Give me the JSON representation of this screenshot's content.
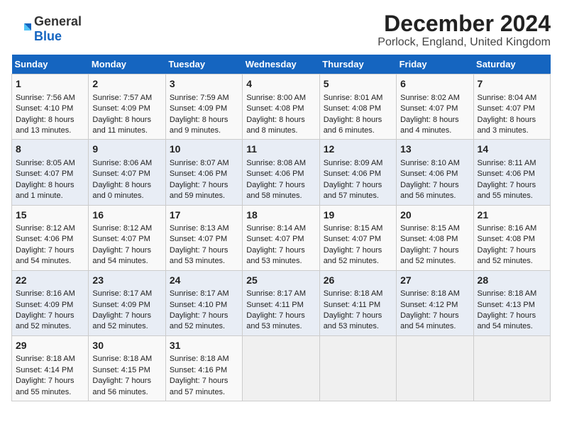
{
  "header": {
    "logo_general": "General",
    "logo_blue": "Blue",
    "month_title": "December 2024",
    "location": "Porlock, England, United Kingdom"
  },
  "weekdays": [
    "Sunday",
    "Monday",
    "Tuesday",
    "Wednesday",
    "Thursday",
    "Friday",
    "Saturday"
  ],
  "weeks": [
    [
      {
        "day": "1",
        "sunrise": "7:56 AM",
        "sunset": "4:10 PM",
        "daylight": "8 hours and 13 minutes."
      },
      {
        "day": "2",
        "sunrise": "7:57 AM",
        "sunset": "4:09 PM",
        "daylight": "8 hours and 11 minutes."
      },
      {
        "day": "3",
        "sunrise": "7:59 AM",
        "sunset": "4:09 PM",
        "daylight": "8 hours and 9 minutes."
      },
      {
        "day": "4",
        "sunrise": "8:00 AM",
        "sunset": "4:08 PM",
        "daylight": "8 hours and 8 minutes."
      },
      {
        "day": "5",
        "sunrise": "8:01 AM",
        "sunset": "4:08 PM",
        "daylight": "8 hours and 6 minutes."
      },
      {
        "day": "6",
        "sunrise": "8:02 AM",
        "sunset": "4:07 PM",
        "daylight": "8 hours and 4 minutes."
      },
      {
        "day": "7",
        "sunrise": "8:04 AM",
        "sunset": "4:07 PM",
        "daylight": "8 hours and 3 minutes."
      }
    ],
    [
      {
        "day": "8",
        "sunrise": "8:05 AM",
        "sunset": "4:07 PM",
        "daylight": "8 hours and 1 minute."
      },
      {
        "day": "9",
        "sunrise": "8:06 AM",
        "sunset": "4:07 PM",
        "daylight": "8 hours and 0 minutes."
      },
      {
        "day": "10",
        "sunrise": "8:07 AM",
        "sunset": "4:06 PM",
        "daylight": "7 hours and 59 minutes."
      },
      {
        "day": "11",
        "sunrise": "8:08 AM",
        "sunset": "4:06 PM",
        "daylight": "7 hours and 58 minutes."
      },
      {
        "day": "12",
        "sunrise": "8:09 AM",
        "sunset": "4:06 PM",
        "daylight": "7 hours and 57 minutes."
      },
      {
        "day": "13",
        "sunrise": "8:10 AM",
        "sunset": "4:06 PM",
        "daylight": "7 hours and 56 minutes."
      },
      {
        "day": "14",
        "sunrise": "8:11 AM",
        "sunset": "4:06 PM",
        "daylight": "7 hours and 55 minutes."
      }
    ],
    [
      {
        "day": "15",
        "sunrise": "8:12 AM",
        "sunset": "4:06 PM",
        "daylight": "7 hours and 54 minutes."
      },
      {
        "day": "16",
        "sunrise": "8:12 AM",
        "sunset": "4:07 PM",
        "daylight": "7 hours and 54 minutes."
      },
      {
        "day": "17",
        "sunrise": "8:13 AM",
        "sunset": "4:07 PM",
        "daylight": "7 hours and 53 minutes."
      },
      {
        "day": "18",
        "sunrise": "8:14 AM",
        "sunset": "4:07 PM",
        "daylight": "7 hours and 53 minutes."
      },
      {
        "day": "19",
        "sunrise": "8:15 AM",
        "sunset": "4:07 PM",
        "daylight": "7 hours and 52 minutes."
      },
      {
        "day": "20",
        "sunrise": "8:15 AM",
        "sunset": "4:08 PM",
        "daylight": "7 hours and 52 minutes."
      },
      {
        "day": "21",
        "sunrise": "8:16 AM",
        "sunset": "4:08 PM",
        "daylight": "7 hours and 52 minutes."
      }
    ],
    [
      {
        "day": "22",
        "sunrise": "8:16 AM",
        "sunset": "4:09 PM",
        "daylight": "7 hours and 52 minutes."
      },
      {
        "day": "23",
        "sunrise": "8:17 AM",
        "sunset": "4:09 PM",
        "daylight": "7 hours and 52 minutes."
      },
      {
        "day": "24",
        "sunrise": "8:17 AM",
        "sunset": "4:10 PM",
        "daylight": "7 hours and 52 minutes."
      },
      {
        "day": "25",
        "sunrise": "8:17 AM",
        "sunset": "4:11 PM",
        "daylight": "7 hours and 53 minutes."
      },
      {
        "day": "26",
        "sunrise": "8:18 AM",
        "sunset": "4:11 PM",
        "daylight": "7 hours and 53 minutes."
      },
      {
        "day": "27",
        "sunrise": "8:18 AM",
        "sunset": "4:12 PM",
        "daylight": "7 hours and 54 minutes."
      },
      {
        "day": "28",
        "sunrise": "8:18 AM",
        "sunset": "4:13 PM",
        "daylight": "7 hours and 54 minutes."
      }
    ],
    [
      {
        "day": "29",
        "sunrise": "8:18 AM",
        "sunset": "4:14 PM",
        "daylight": "7 hours and 55 minutes."
      },
      {
        "day": "30",
        "sunrise": "8:18 AM",
        "sunset": "4:15 PM",
        "daylight": "7 hours and 56 minutes."
      },
      {
        "day": "31",
        "sunrise": "8:18 AM",
        "sunset": "4:16 PM",
        "daylight": "7 hours and 57 minutes."
      },
      null,
      null,
      null,
      null
    ]
  ]
}
